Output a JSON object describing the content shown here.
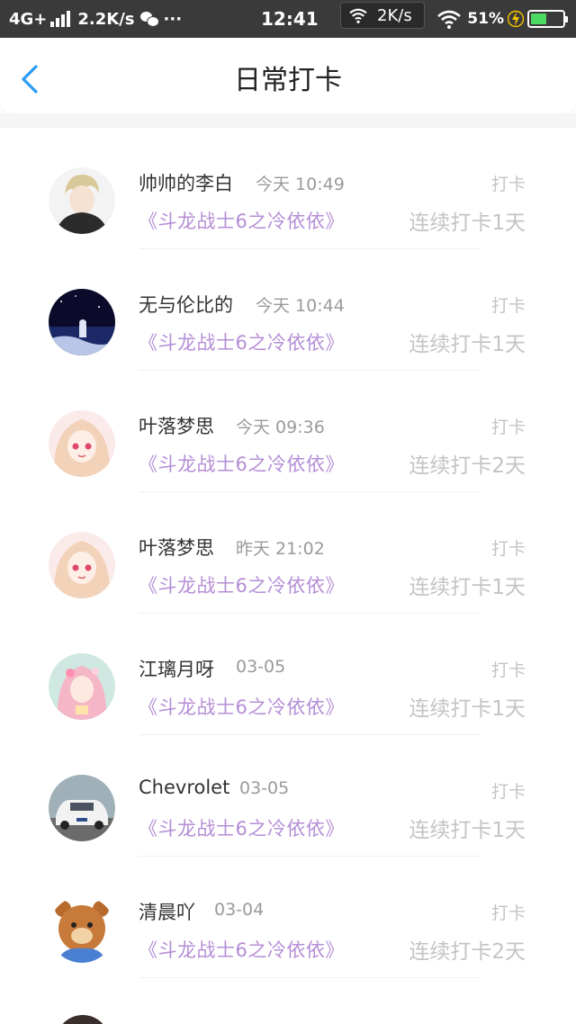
{
  "status_bar": {
    "network": "4G+",
    "speed": "2.2K/s",
    "dots": "···",
    "time": "12:41",
    "floating_speed": "2K/s",
    "battery": "51%",
    "colors": {
      "bg": "#3a3a3a",
      "battery_fill": "#4cd964",
      "charge_bolt": "#f2c200"
    }
  },
  "header": {
    "title": "日常打卡",
    "back_icon": "chevron-left-icon",
    "accent": "#2a9df4"
  },
  "list": {
    "items": [
      {
        "name": "帅帅的李白",
        "time": "今天 10:49",
        "book": "《斗龙战士6之冷依依》",
        "action": "打卡",
        "streak": "连续打卡1天"
      },
      {
        "name": "无与伦比的",
        "time": "今天 10:44",
        "book": "《斗龙战士6之冷依依》",
        "action": "打卡",
        "streak": "连续打卡1天"
      },
      {
        "name": "叶落梦思",
        "time": "今天 09:36",
        "book": "《斗龙战士6之冷依依》",
        "action": "打卡",
        "streak": "连续打卡2天"
      },
      {
        "name": "叶落梦思",
        "time": "昨天 21:02",
        "book": "《斗龙战士6之冷依依》",
        "action": "打卡",
        "streak": "连续打卡1天"
      },
      {
        "name": "江璃月呀",
        "time": "03-05",
        "book": "《斗龙战士6之冷依依》",
        "action": "打卡",
        "streak": "连续打卡1天"
      },
      {
        "name": "Chevrolet",
        "time": "03-05",
        "book": "《斗龙战士6之冷依依》",
        "action": "打卡",
        "streak": "连续打卡1天"
      },
      {
        "name": "清晨吖",
        "time": "03-04",
        "book": "《斗龙战士6之冷依依》",
        "action": "打卡",
        "streak": "连续打卡2天"
      }
    ],
    "colors": {
      "book": "#b58ed6",
      "muted": "#c4c4c4",
      "time": "#9a9a9a"
    }
  }
}
